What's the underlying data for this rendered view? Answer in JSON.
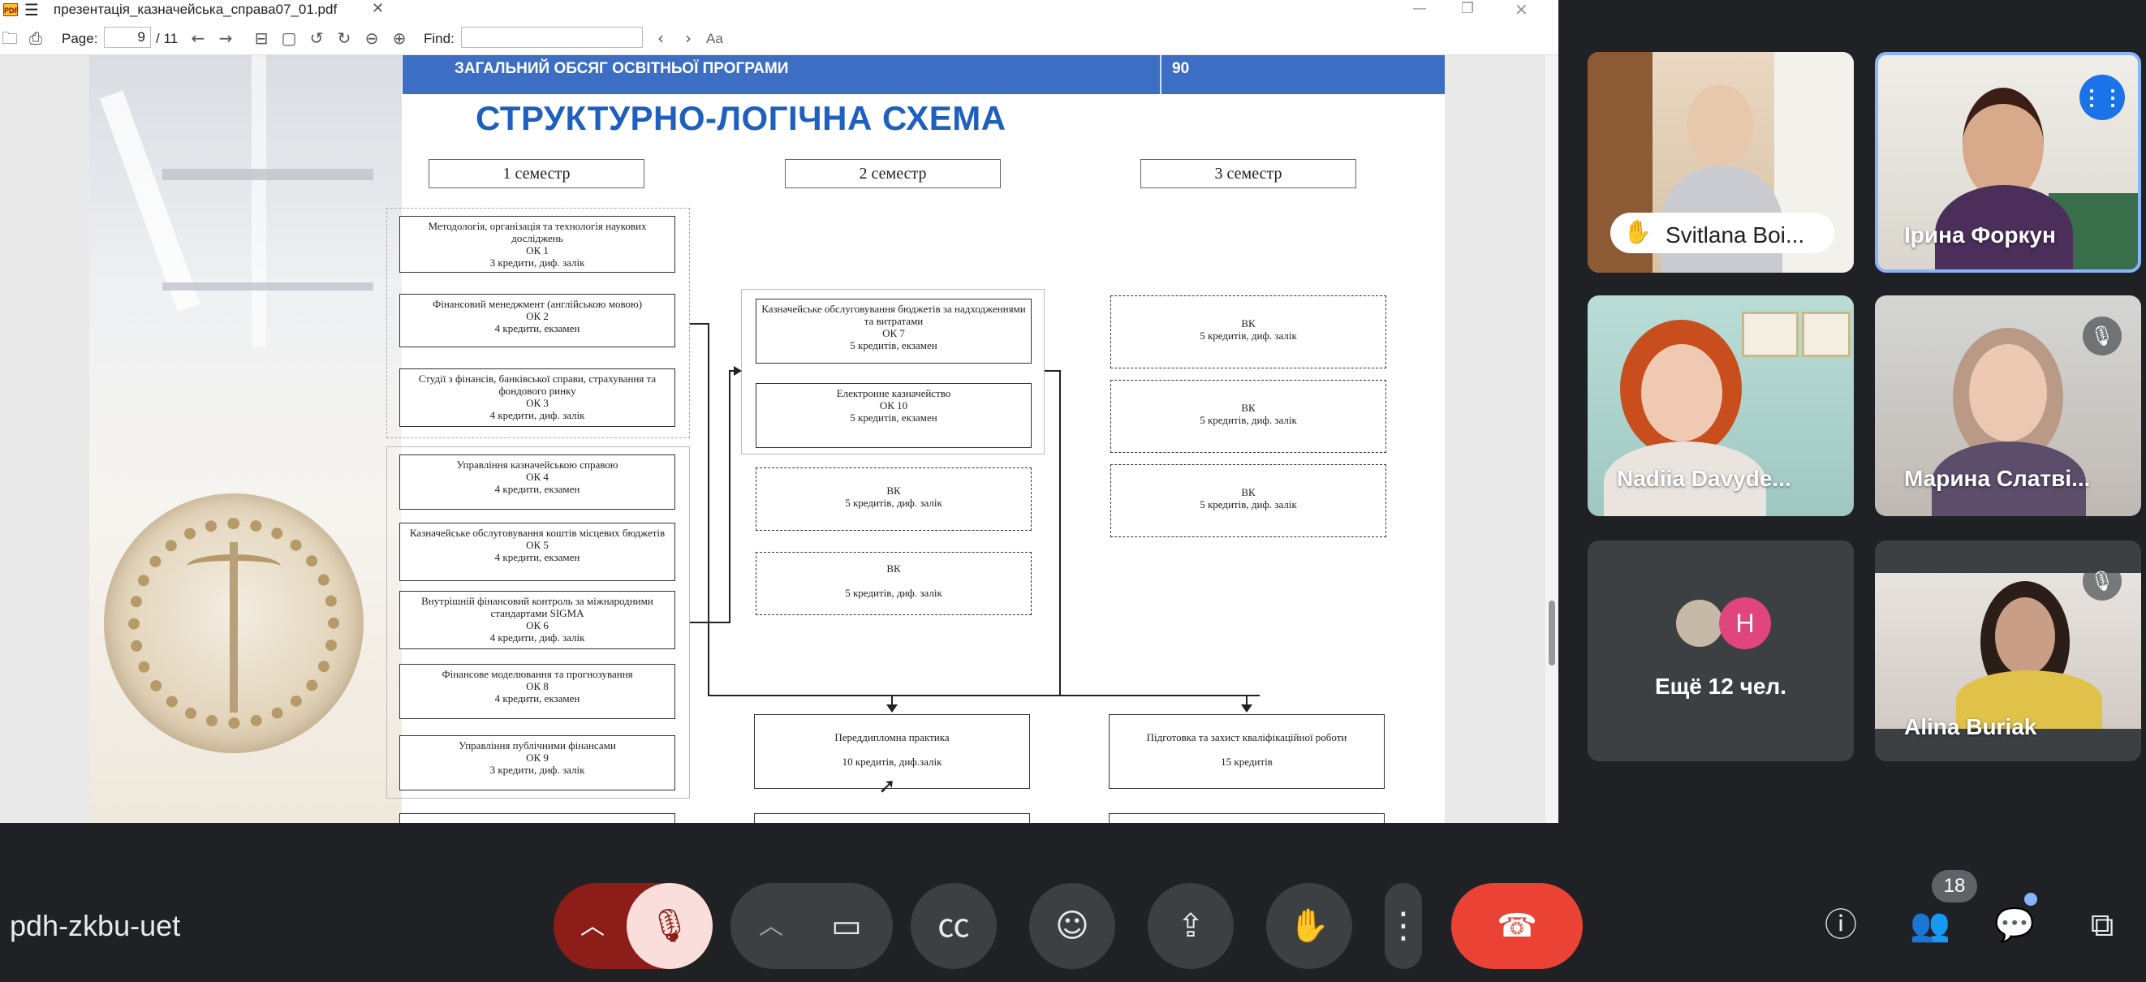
{
  "pdf": {
    "app_icon": "pdf-app-icon",
    "filename": "презентація_казначейська_справа07_01.pdf",
    "page_label": "Page:",
    "page_current": "9",
    "page_total": "/ 11",
    "find_label": "Find:",
    "find_value": "",
    "case_label": "Aa"
  },
  "slide": {
    "header_left": "ЗАГАЛЬНИЙ ОБСЯГ ОСВІТНЬОЇ ПРОГРАМИ",
    "header_right": "90",
    "title": "СТРУКТУРНО-ЛОГІЧНА СХЕМА",
    "semesters": [
      "1 семестр",
      "2 семестр",
      "3 семестр"
    ],
    "sem1_courses": [
      "Методологія, організація та технологія наукових досліджень\nОК 1\n3 кредити, диф. залік",
      "Фінансовий менеджмент (англійською мовою)\nОК 2\n4 кредити, екзамен",
      "Студії з фінансів, банківської справи, страхування та фондового ринку\nОК 3\n4 кредити, диф. залік",
      "Управління казначейською справою\nОК 4\n4 кредити, екзамен",
      "Казначейське обслуговування коштів місцевих бюджетів\nОК 5\n4 кредити, екзамен",
      "Внутрішній фінансовий контроль за міжнародними стандартами SIGMA\nОК 6\n4 кредити, диф. залік",
      "Фінансове моделювання та прогнозування\nОК 8\n4 кредити, екзамен",
      "Управління публічними фінансами\nОК 9\n3 кредити, диф. залік"
    ],
    "sem2_courses": [
      "Казначейське обслуговування бюджетів за надходженнями та витратами\nОК 7\n5 кредитів, екзамен",
      "Електронне казначейство\nОК 10\n5 кредитів, екзамен",
      "ВК\n5 кредитів, диф. залік",
      "ВК\n\n5 кредитів, диф. залік"
    ],
    "sem3_courses": [
      "ВК\n5 кредитів, диф. залік",
      "ВК\n5 кредитів, диф. залік",
      "ВК\n5 кредитів, диф. залік"
    ],
    "practice": "Переддипломна практика\n\n10 кредитів, диф.залік",
    "thesis": "Підготовка та захист кваліфікаційної роботи\n\n15 кредитів"
  },
  "participants": [
    {
      "name": "Svitlana Boi...",
      "hand_raised": true
    },
    {
      "name": "Ірина Форкун",
      "speaking": true
    },
    {
      "name": "Nadiia Davyde..."
    },
    {
      "name": "Марина Слатві...",
      "muted": true
    },
    {
      "name": "Ещё 12 чел.",
      "avatar_letter": "H"
    },
    {
      "name": "Alina Buriak",
      "muted": true
    }
  ],
  "meeting": {
    "code": "pdh-zkbu-uet",
    "participant_count": "18"
  },
  "colors": {
    "background": "#202124",
    "control": "#3c4043",
    "end_call": "#ea4335",
    "mic_off": "#f9dedc",
    "mic_group": "#8c1d18",
    "speaking_border": "#8ab4f8",
    "slide_blue": "#3c6fc3"
  }
}
